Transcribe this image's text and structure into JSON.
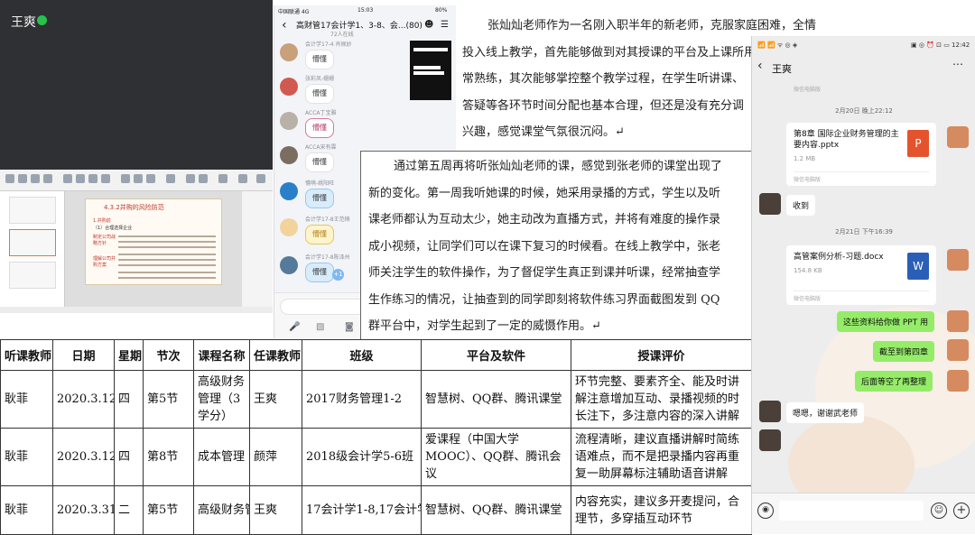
{
  "meeting": {
    "presenter_name": "王爽",
    "slide": {
      "title": "4.3.2并购的风险防范",
      "heading": "1.并购前",
      "subheading": "（1）合理选择企业",
      "side_labels": [
        "制定公司战略方针",
        "理解公司并购方案"
      ]
    }
  },
  "qq_group": {
    "status_bar": {
      "carrier": "中国联通 4G",
      "time": "15:03",
      "battery": "80%"
    },
    "title": "高财管17会计学1、3-8、会...(80)",
    "online": "72人在线",
    "messages": [
      {
        "nick": "会计学17-4 肖佩妙",
        "sticker": "懵懂",
        "style": "plain",
        "avatar": "#c8a07a"
      },
      {
        "nick": "张彩凤-姗姗",
        "sticker": "懵懂",
        "style": "plain",
        "avatar": "#d05a50"
      },
      {
        "nick": "ACCA丁宝雅",
        "sticker": "懵懂",
        "style": "pink",
        "avatar": "#b9b0a8"
      },
      {
        "nick": "ACCA宋有霖",
        "sticker": "懵懂",
        "style": "plain",
        "avatar": "#7b6d60"
      },
      {
        "nick": "懵萌-姚阳旺",
        "sticker": "懵懂",
        "style": "blue",
        "avatar": "#2a7fc9"
      },
      {
        "nick": "会计学17-8王范楠",
        "sticker": "懵懂",
        "style": "yel",
        "avatar": "#f2d39c"
      },
      {
        "nick": "会计学17-8陈泽州",
        "sticker": "懵懂",
        "style": "blue",
        "avatar": "#557a9a"
      }
    ],
    "plus_label": "+1"
  },
  "doc1": {
    "lines": [
      "张灿灿老师作为一名刚入职半年的新老师，克服家庭困难，全情",
      "投入线上教学，首先能够做到对其授课的平台及上课所用",
      "常熟练，其次能够掌控整个教学过程，在学生听讲课、",
      "答疑等各环节时间分配也基本合理，但还是没有充分调",
      "兴趣，感觉课堂气氛很沉闷。↵"
    ]
  },
  "doc2": {
    "lines": [
      "通过第五周再将听张灿灿老师的课，感觉到张老师的课堂出现了",
      "新的变化。第一周我听她课的时候，她采用录播的方式，学生以及听",
      "课老师都认为互动太少，她主动改为直播方式，并将有难度的操作录",
      "成小视频，让同学们可以在课下复习的时候看。在线上教学中，张老",
      "师关注学生的软件操作，为了督促学生真正到课并听课，经常抽查学",
      "生作练习的情况，让抽查到的同学即刻将软件练习界面截图发到 QQ",
      "群平台中，对学生起到了一定的威慑作用。↵"
    ]
  },
  "table": {
    "headers": [
      "听课教师",
      "日期",
      "星期",
      "节次",
      "课程名称",
      "任课教师",
      "班级",
      "平台及软件",
      "授课评价"
    ],
    "rows": [
      [
        "耿菲",
        "2020.3.12",
        "四",
        "第5节",
        "高级财务管理（3学分）",
        "王爽",
        "2017财务管理1-2",
        "智慧树、QQ群、腾讯课堂",
        "环节完整、要素齐全、能及时讲解注意增加互动、录播视频的时长注下，多注意内容的深入讲解"
      ],
      [
        "耿菲",
        "2020.3.12",
        "四",
        "第8节",
        "成本管理",
        "颜萍",
        "2018级会计学5-6班",
        "爱课程（中国大学MOOC）、QQ群、腾讯会议",
        "流程清晰，建议直播讲解时简练语难点，而不是把录播内容再重复一助屏幕标注辅助语音讲解"
      ],
      [
        "耿菲",
        "2020.3.31",
        "二",
        "第5节",
        "高级财务管",
        "王爽",
        "17会计学1-8,17会计学",
        "智慧树、QQ群、腾讯课堂",
        "内容充实，建议多开麦提问，合理节，多穿插互动环节"
      ]
    ]
  },
  "wechat": {
    "status_bar": {
      "left": "📶 📶 ᯤ ◎ ◈",
      "right": "▣ ◎ ⏰ ⊡ ▭ 12:42"
    },
    "title": "王爽",
    "items": [
      {
        "kind": "src",
        "text": "微信电脑版"
      },
      {
        "kind": "time",
        "text": "2月20日 晚上22:12"
      },
      {
        "kind": "file",
        "name": "第8章 国际企业财务管理的主要内容.pptx",
        "size": "1.2 MB",
        "icon": "P",
        "icon_color": "#e5532d",
        "source": "微信电脑版"
      },
      {
        "kind": "text_in",
        "text": "收到"
      },
      {
        "kind": "time",
        "text": "2月21日 下午16:39"
      },
      {
        "kind": "file",
        "name": "高管案例分析-习题.docx",
        "size": "154.8 KB",
        "icon": "W",
        "icon_color": "#2b5fb7",
        "source": "微信电脑版"
      },
      {
        "kind": "text_out",
        "text": "这些资料给你做 PPT 用"
      },
      {
        "kind": "text_out",
        "text": "截至到第四章"
      },
      {
        "kind": "text_out",
        "text": "后面等空了再整理"
      },
      {
        "kind": "text_in",
        "text": "嗯嗯，谢谢武老师"
      }
    ]
  }
}
